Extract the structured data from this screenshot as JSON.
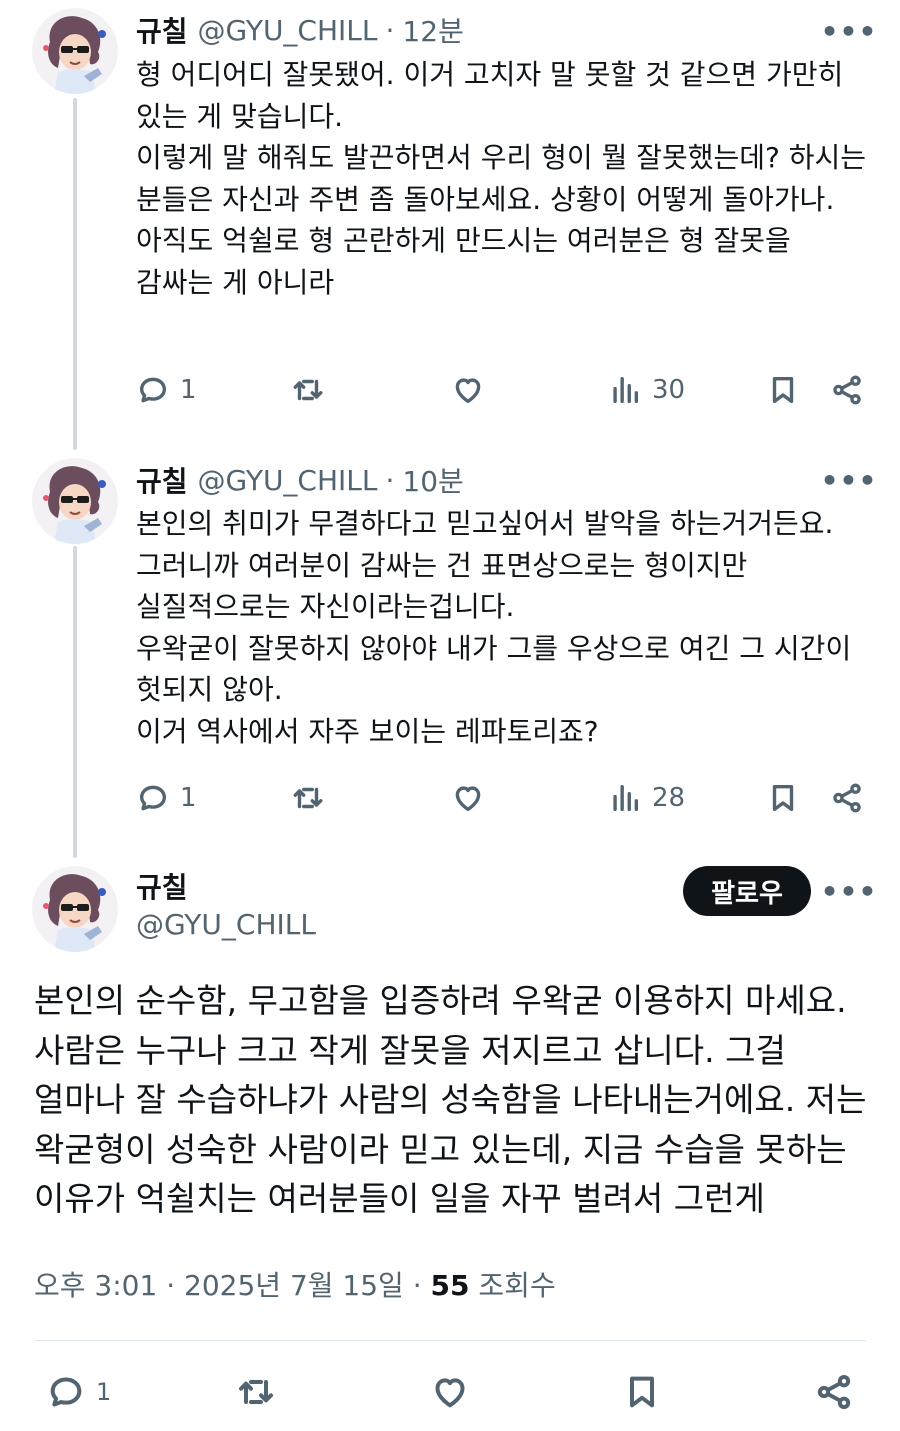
{
  "thread": [
    {
      "name": "규칠",
      "handle": "@GYU_CHILL",
      "separator": "·",
      "time": "12분",
      "paragraphs": [
        "형 어디어디 잘못됐어. 이거 고치자 말 못할 것 같으면 가만히 있는 게 맞습니다.",
        "이렇게 말 해줘도 발끈하면서 우리 형이 뭘 잘못했는데? 하시는 분들은 자신과 주변 좀 돌아보세요. 상황이 어떻게 돌아가나.",
        "아직도 억쉴로 형 곤란하게 만드시는 여러분은 형 잘못을 감싸는 게 아니라"
      ],
      "replies": "1",
      "views": "30"
    },
    {
      "name": "규칠",
      "handle": "@GYU_CHILL",
      "separator": "·",
      "time": "10분",
      "paragraphs": [
        "본인의 취미가 무결하다고 믿고싶어서 발악을 하는거거든요.",
        "그러니까 여러분이 감싸는 건 표면상으로는 형이지만 실질적으로는 자신이라는겁니다.",
        "우왁굳이 잘못하지 않아야 내가 그를 우상으로 여긴 그 시간이 헛되지 않아.",
        "이거 역사에서 자주 보이는 레파토리죠?"
      ],
      "replies": "1",
      "views": "28"
    }
  ],
  "main": {
    "name": "규칠",
    "handle": "@GYU_CHILL",
    "follow_label": "팔로우",
    "text": "본인의 순수함, 무고함을 입증하려 우왁굳 이용하지 마세요. 사람은 누구나 크고 작게 잘못을 저지르고 삽니다. 그걸 얼마나 잘 수습하냐가 사람의 성숙함을 나타내는거에요. 저는 왁굳형이 성숙한 사람이라 믿고 있는데, 지금 수습을 못하는 이유가 억쉴치는 여러분들이 일을 자꾸 벌려서 그런게",
    "time": "오후 3:01",
    "dot": "·",
    "date": "2025년 7월 15일",
    "views_count": "55",
    "views_label": "조회수",
    "replies": "1"
  },
  "icons": {
    "more": "more-icon",
    "reply": "reply-icon",
    "retweet": "retweet-icon",
    "like": "like-icon",
    "views": "views-icon",
    "bookmark": "bookmark-icon",
    "share": "share-icon"
  },
  "colors": {
    "text": "#0f1419",
    "muted": "#536471",
    "thread_line": "#cfd9de",
    "follow_bg": "#0f1419"
  }
}
